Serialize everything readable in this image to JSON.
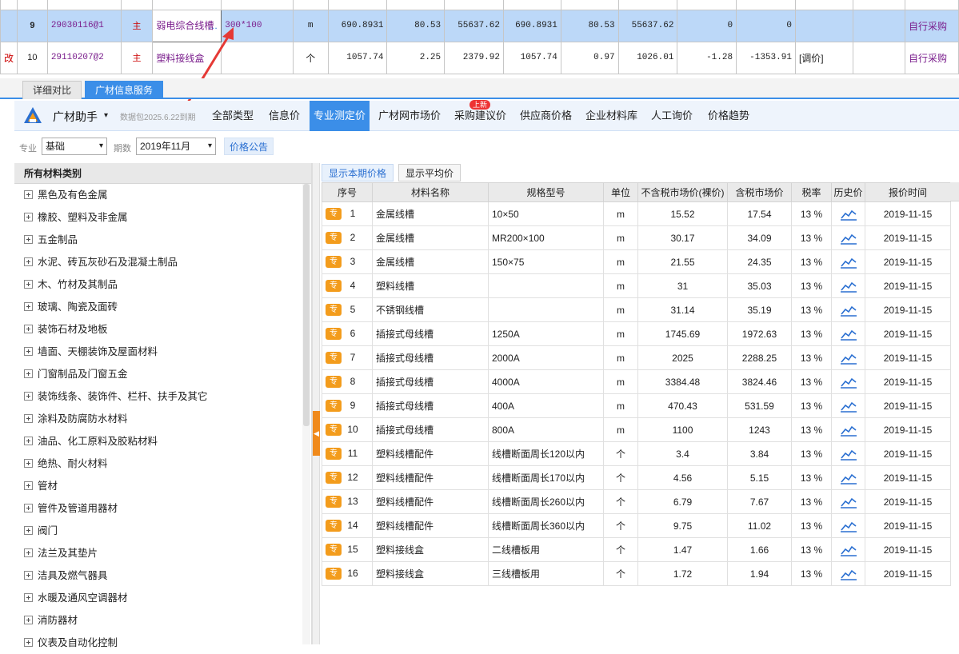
{
  "top_rows": [
    {
      "rownum": "9",
      "code": "29030116@1",
      "main": "主",
      "name": "弱电综合线槽",
      "spec": "300*100",
      "unit": "m",
      "c1": "690.8931",
      "c2": "80.53",
      "c3": "55637.62",
      "c4": "690.8931",
      "c5": "80.53",
      "c6": "55637.62",
      "c7": "0",
      "c8": "0",
      "note": "",
      "source": "自行采购",
      "ellipsis": "…"
    },
    {
      "prefix": "改",
      "rownum": "10",
      "code": "29110207@2",
      "main": "主",
      "name": "塑料接线盒",
      "spec": "",
      "unit": "个",
      "c1": "1057.74",
      "c2": "2.25",
      "c3": "2379.92",
      "c4": "1057.74",
      "c5": "0.97",
      "c6": "1026.01",
      "c7": "-1.28",
      "c8": "-1353.91",
      "note": "[调价]",
      "source": "自行采购"
    }
  ],
  "tabs": [
    "详细对比",
    "广材信息服务"
  ],
  "toolbar": {
    "brand": "广材助手",
    "caret": "▾",
    "pkg": "数据包2025.6.22到期",
    "nav": [
      "全部类型",
      "信息价",
      "专业测定价",
      "广材网市场价",
      "采购建议价",
      "供应商价格",
      "企业材料库",
      "人工询价",
      "价格趋势"
    ],
    "new_badge": "上新"
  },
  "filters": {
    "major_label": "专业",
    "major_value": "基础",
    "period_label": "期数",
    "period_value": "2019年11月",
    "notice": "价格公告",
    "caret": "▾"
  },
  "categories_header": "所有材料类别",
  "categories": [
    "黑色及有色金属",
    "橡胶、塑料及非金属",
    "五金制品",
    "水泥、砖瓦灰砂石及混凝土制品",
    "木、竹材及其制品",
    "玻璃、陶瓷及面砖",
    "装饰石材及地板",
    "墙面、天棚装饰及屋面材料",
    "门窗制品及门窗五金",
    "装饰线条、装饰件、栏杆、扶手及其它",
    "涂料及防腐防水材料",
    "油品、化工原料及胶粘材料",
    "绝热、耐火材料",
    "管材",
    "管件及管道用器材",
    "阀门",
    "法兰及其垫片",
    "洁具及燃气器具",
    "水暖及通风空调器材",
    "消防器材",
    "仪表及自动化控制"
  ],
  "price_tabs": [
    "显示本期价格",
    "显示平均价"
  ],
  "columns": [
    "序号",
    "材料名称",
    "规格型号",
    "单位",
    "不含税市场价(裸价)",
    "含税市场价",
    "税率",
    "历史价",
    "报价时间"
  ],
  "badge": "专",
  "rows": [
    {
      "no": "1",
      "name": "金属线槽",
      "spec": "10×50",
      "unit": "m",
      "net": "15.52",
      "gross": "17.54",
      "tax": "13 %",
      "date": "2019-11-15"
    },
    {
      "no": "2",
      "name": "金属线槽",
      "spec": "MR200×100",
      "unit": "m",
      "net": "30.17",
      "gross": "34.09",
      "tax": "13 %",
      "date": "2019-11-15"
    },
    {
      "no": "3",
      "name": "金属线槽",
      "spec": "150×75",
      "unit": "m",
      "net": "21.55",
      "gross": "24.35",
      "tax": "13 %",
      "date": "2019-11-15"
    },
    {
      "no": "4",
      "name": "塑料线槽",
      "spec": "",
      "unit": "m",
      "net": "31",
      "gross": "35.03",
      "tax": "13 %",
      "date": "2019-11-15"
    },
    {
      "no": "5",
      "name": "不锈钢线槽",
      "spec": "",
      "unit": "m",
      "net": "31.14",
      "gross": "35.19",
      "tax": "13 %",
      "date": "2019-11-15"
    },
    {
      "no": "6",
      "name": "插接式母线槽",
      "spec": "1250A",
      "unit": "m",
      "net": "1745.69",
      "gross": "1972.63",
      "tax": "13 %",
      "date": "2019-11-15"
    },
    {
      "no": "7",
      "name": "插接式母线槽",
      "spec": "2000A",
      "unit": "m",
      "net": "2025",
      "gross": "2288.25",
      "tax": "13 %",
      "date": "2019-11-15"
    },
    {
      "no": "8",
      "name": "插接式母线槽",
      "spec": "4000A",
      "unit": "m",
      "net": "3384.48",
      "gross": "3824.46",
      "tax": "13 %",
      "date": "2019-11-15"
    },
    {
      "no": "9",
      "name": "插接式母线槽",
      "spec": "400A",
      "unit": "m",
      "net": "470.43",
      "gross": "531.59",
      "tax": "13 %",
      "date": "2019-11-15"
    },
    {
      "no": "10",
      "name": "插接式母线槽",
      "spec": "800A",
      "unit": "m",
      "net": "1100",
      "gross": "1243",
      "tax": "13 %",
      "date": "2019-11-15"
    },
    {
      "no": "11",
      "name": "塑料线槽配件",
      "spec": "线槽断面周长120以内",
      "unit": "个",
      "net": "3.4",
      "gross": "3.84",
      "tax": "13 %",
      "date": "2019-11-15"
    },
    {
      "no": "12",
      "name": "塑料线槽配件",
      "spec": "线槽断面周长170以内",
      "unit": "个",
      "net": "4.56",
      "gross": "5.15",
      "tax": "13 %",
      "date": "2019-11-15"
    },
    {
      "no": "13",
      "name": "塑料线槽配件",
      "spec": "线槽断面周长260以内",
      "unit": "个",
      "net": "6.79",
      "gross": "7.67",
      "tax": "13 %",
      "date": "2019-11-15"
    },
    {
      "no": "14",
      "name": "塑料线槽配件",
      "spec": "线槽断面周长360以内",
      "unit": "个",
      "net": "9.75",
      "gross": "11.02",
      "tax": "13 %",
      "date": "2019-11-15"
    },
    {
      "no": "15",
      "name": "塑料接线盒",
      "spec": "二线槽板用",
      "unit": "个",
      "net": "1.47",
      "gross": "1.66",
      "tax": "13 %",
      "date": "2019-11-15"
    },
    {
      "no": "16",
      "name": "塑料接线盒",
      "spec": "三线槽板用",
      "unit": "个",
      "net": "1.72",
      "gross": "1.94",
      "tax": "13 %",
      "date": "2019-11-15"
    }
  ],
  "colors": {
    "accent": "#3b8ee8",
    "badge": "#f39c1c",
    "arrow": "#e53935",
    "selected_row": "#bcd8f8",
    "text_purple": "#7a1d8c"
  },
  "icons": {
    "trend": "line-chart-icon",
    "logo": "guangcai-logo-icon"
  }
}
